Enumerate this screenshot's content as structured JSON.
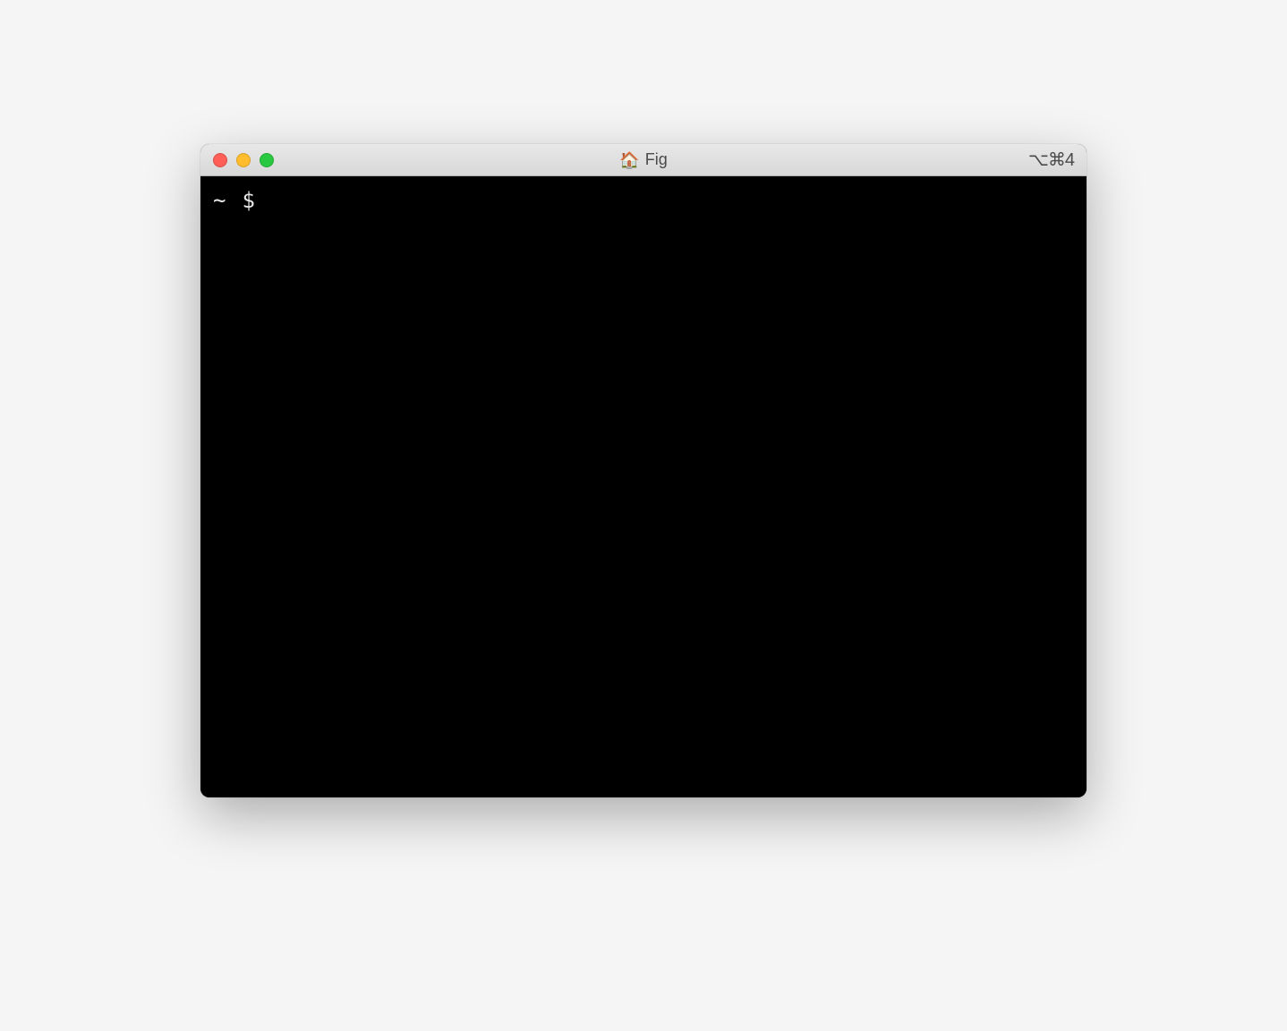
{
  "window": {
    "title_icon": "🏠",
    "title": "Fig",
    "shortcut": "⌥⌘4"
  },
  "terminal": {
    "cwd": "~",
    "prompt_symbol": "$",
    "input": ""
  }
}
